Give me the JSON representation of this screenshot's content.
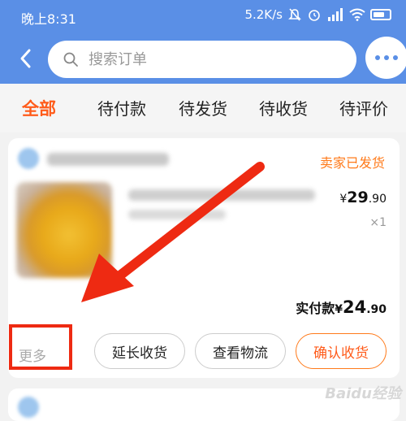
{
  "status_bar": {
    "time": "晚上8:31",
    "speed": "5.2K/s",
    "battery": "68"
  },
  "search": {
    "placeholder": "搜索订单"
  },
  "tabs": [
    {
      "label": "全部",
      "active": true
    },
    {
      "label": "待付款",
      "active": false
    },
    {
      "label": "待发货",
      "active": false
    },
    {
      "label": "待收货",
      "active": false
    },
    {
      "label": "待评价",
      "active": false
    }
  ],
  "order": {
    "status": "卖家已发货",
    "price_currency": "¥",
    "price_int": "29",
    "price_dec": ".90",
    "quantity": "×1",
    "paid_label": "实付款",
    "paid_currency": "¥",
    "paid_int": "24",
    "paid_dec": ".90",
    "more": "更多",
    "buttons": {
      "extend": "延长收货",
      "logistics": "查看物流",
      "confirm": "确认收货"
    }
  },
  "colors": {
    "header": "#5a8fe6",
    "accent": "#ff5b1a",
    "annotation": "#ee2a12"
  },
  "watermark": "Baidu经验"
}
